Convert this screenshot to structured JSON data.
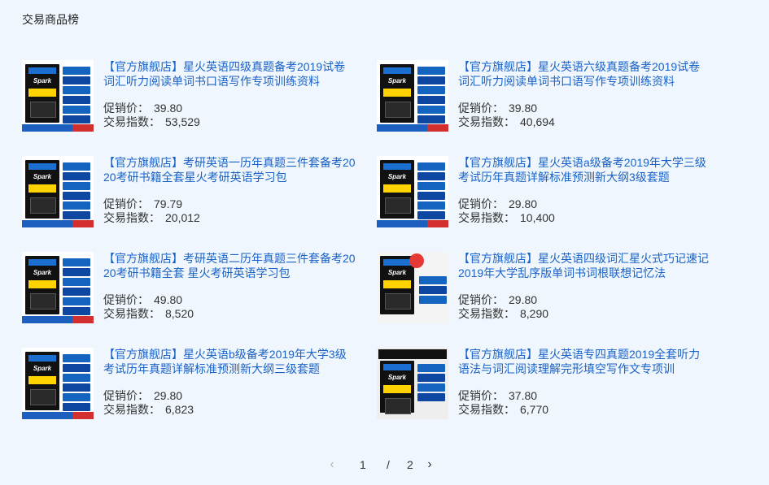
{
  "section": {
    "title": "交易商品榜"
  },
  "labels": {
    "price": "促销价：",
    "index": "交易指数："
  },
  "items": [
    {
      "title": "【官方旗舰店】星火英语四级真题备考2019试卷词汇听力阅读单词书口语写作专项训练资料",
      "price": "39.80",
      "index": "53,529",
      "thumb_icon": "book-cover-cet4-icon"
    },
    {
      "title": "【官方旗舰店】星火英语六级真题备考2019试卷词汇听力阅读单词书口语写作专项训练资料",
      "price": "39.80",
      "index": "40,694",
      "thumb_icon": "book-cover-cet6-icon"
    },
    {
      "title": "【官方旗舰店】考研英语一历年真题三件套备考2020考研书籍全套星火考研英语学习包",
      "price": "79.79",
      "index": "20,012",
      "thumb_icon": "book-cover-kaoyan1-icon"
    },
    {
      "title": "【官方旗舰店】星火英语a级备考2019年大学三级考试历年真题详解标准预测新大纲3级套题",
      "price": "29.80",
      "index": "10,400",
      "thumb_icon": "book-cover-level-a-icon"
    },
    {
      "title": "【官方旗舰店】考研英语二历年真题三件套备考2020考研书籍全套 星火考研英语学习包",
      "price": "49.80",
      "index": "8,520",
      "thumb_icon": "book-cover-kaoyan2-icon"
    },
    {
      "title": "【官方旗舰店】星火英语四级词汇星火式巧记速记2019年大学乱序版单词书词根联想记忆法",
      "price": "29.80",
      "index": "8,290",
      "thumb_icon": "book-cover-cet4-vocab-icon"
    },
    {
      "title": "【官方旗舰店】星火英语b级备考2019年大学3级考试历年真题详解标准预测新大纲三级套题",
      "price": "29.80",
      "index": "6,823",
      "thumb_icon": "book-cover-level-b-icon"
    },
    {
      "title": "【官方旗舰店】星火英语专四真题2019全套听力语法与词汇阅读理解完形填空写作文专项训",
      "price": "37.80",
      "index": "6,770",
      "thumb_icon": "book-cover-tem4-icon"
    }
  ],
  "pager": {
    "prev_icon": "chevron-left-icon",
    "current": "1",
    "separator": "/",
    "total": "2",
    "next_icon": "chevron-right-icon",
    "prev_glyph": "‹",
    "next_glyph": "›"
  }
}
